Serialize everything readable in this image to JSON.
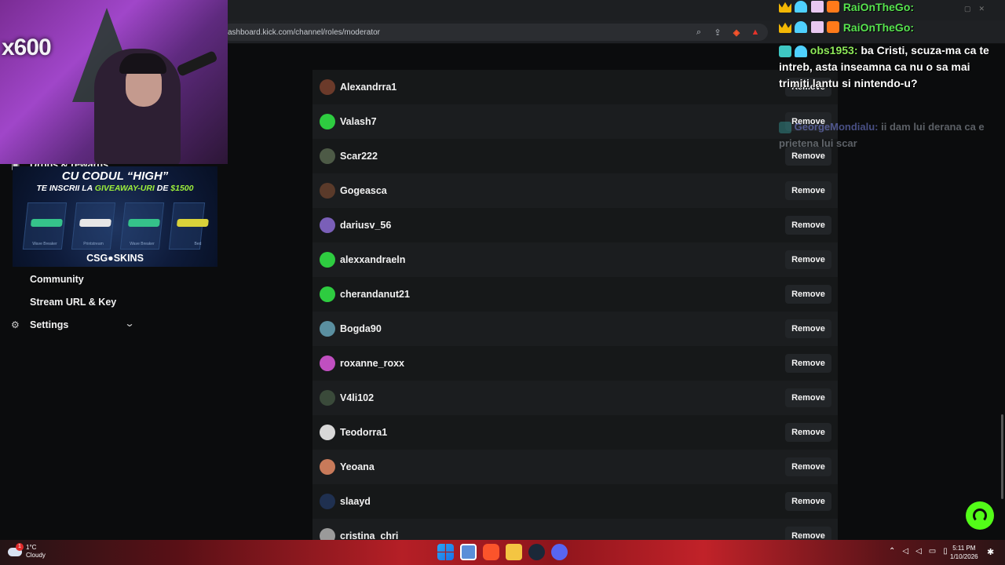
{
  "browser": {
    "url": "ashboard.kick.com/channel/roles/moderator"
  },
  "sidebar": {
    "items": [
      {
        "label": "Drops & rewards"
      },
      {
        "label": "Community"
      },
      {
        "label": "Stream URL & Key"
      },
      {
        "label": "Settings"
      }
    ]
  },
  "webcam": {
    "multiplier": "x600"
  },
  "promo": {
    "line1_prefix": "CU CODUL ",
    "line1_code": "“HIGH”",
    "line2_prefix": "TE INSCRII LA ",
    "line2_green": "GIVEAWAY-URI",
    "line2_mid": " DE ",
    "line2_amount": "$1500",
    "skins": [
      "Wave Breaker",
      "Printstream",
      "Wave Breaker",
      "Bed"
    ],
    "brand": "CSG●SKINS"
  },
  "chat": {
    "repeat_user": "RaiOnTheGo:",
    "message_user": "obs1953:",
    "message_text": "ba Cristi, scuza-ma ca te intreb, asta inseamna ca nu o sa mai trimiti lantu si nintendo-u?",
    "faded_user": "GeorgeMondialu:",
    "faded_text": "ii dam lui derana ca e prietena lui scar"
  },
  "moderators": {
    "remove_label": "Remove",
    "list": [
      {
        "name": "Alexandrra1",
        "avatar_color": "#6b3a2a"
      },
      {
        "name": "Valash7",
        "avatar_color": "#2ecc40"
      },
      {
        "name": "Scar222",
        "avatar_color": "#4d5a46"
      },
      {
        "name": "Gogeasca",
        "avatar_color": "#5a3a2a"
      },
      {
        "name": "dariusv_56",
        "avatar_color": "#7a5fb8"
      },
      {
        "name": "alexxandraeln",
        "avatar_color": "#2ecc40"
      },
      {
        "name": "cherandanut21",
        "avatar_color": "#2ecc40"
      },
      {
        "name": "Bogda90",
        "avatar_color": "#5a8fa0"
      },
      {
        "name": "roxanne_roxx",
        "avatar_color": "#c04fc0"
      },
      {
        "name": "V4li102",
        "avatar_color": "#3a4a3a"
      },
      {
        "name": "Teodorra1",
        "avatar_color": "#d8d8d8"
      },
      {
        "name": "Yeoana",
        "avatar_color": "#c87a5a"
      },
      {
        "name": "slaayd",
        "avatar_color": "#1f3050"
      },
      {
        "name": "cristina_chri",
        "avatar_color": "#9a9a9a"
      }
    ]
  },
  "taskbar": {
    "temperature": "1°C",
    "condition": "Cloudy",
    "notification_count": "1",
    "time": "5:11 PM",
    "date": "1/10/2026"
  },
  "colors": {
    "accent": "#53fc18",
    "row_odd": "#161819",
    "row_even": "#1b1d1f"
  }
}
